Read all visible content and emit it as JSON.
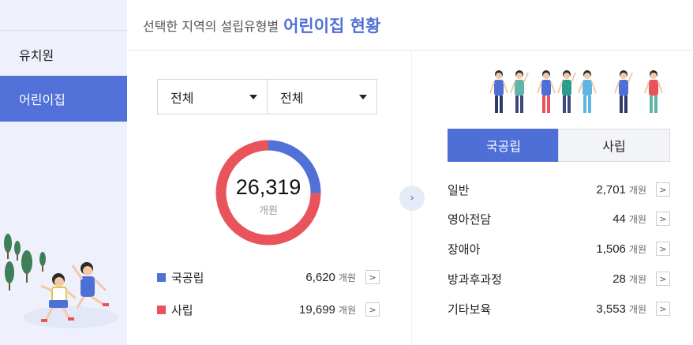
{
  "sidebar": {
    "items": [
      {
        "label": "유치원"
      },
      {
        "label": "어린이집"
      }
    ]
  },
  "header": {
    "prefix": "선택한 지역의 설립유형별",
    "highlight": "어린이집 현황"
  },
  "filters": {
    "region1": "전체",
    "region2": "전체"
  },
  "summary": {
    "total": "26,319",
    "unit": "개원",
    "arrow": ">"
  },
  "legend": [
    {
      "label": "국공립",
      "value": "6,620",
      "unit": "개원",
      "color": "#5171d9"
    },
    {
      "label": "사립",
      "value": "19,699",
      "unit": "개원",
      "color": "#e8535c"
    }
  ],
  "chart_data": {
    "type": "pie",
    "categories": [
      "국공립",
      "사립"
    ],
    "values": [
      6620,
      19699
    ],
    "colors": [
      "#5171d9",
      "#e8535c"
    ],
    "total_label": "26,319",
    "unit": "개원"
  },
  "tabs": [
    {
      "label": "국공립",
      "active": true
    },
    {
      "label": "사립",
      "active": false
    }
  ],
  "stats": [
    {
      "label": "일반",
      "value": "2,701",
      "unit": "개원"
    },
    {
      "label": "영아전담",
      "value": "44",
      "unit": "개원"
    },
    {
      "label": "장애아",
      "value": "1,506",
      "unit": "개원"
    },
    {
      "label": "방과후과정",
      "value": "28",
      "unit": "개원"
    },
    {
      "label": "기타보육",
      "value": "3,553",
      "unit": "개원"
    }
  ],
  "ui": {
    "row_arrow": ">",
    "next_arrow": "›"
  }
}
